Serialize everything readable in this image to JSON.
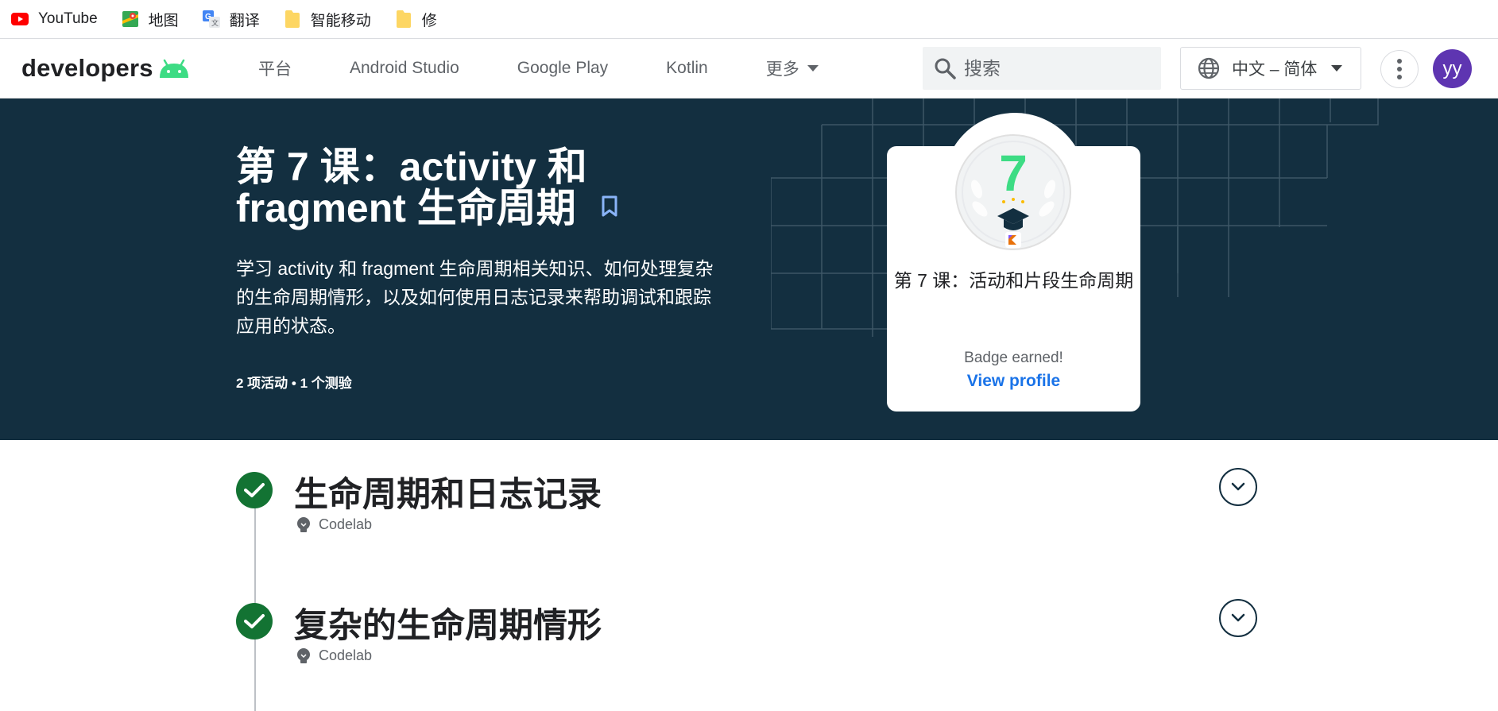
{
  "bookmarks": [
    {
      "label": "YouTube",
      "icon": "youtube-icon"
    },
    {
      "label": "地图",
      "icon": "maps-icon"
    },
    {
      "label": "翻译",
      "icon": "translate-icon"
    },
    {
      "label": "智能移动",
      "icon": "folder-icon"
    },
    {
      "label": "修",
      "icon": "folder-icon"
    }
  ],
  "nav": {
    "logo_text": "developers",
    "links": [
      "平台",
      "Android Studio",
      "Google Play",
      "Kotlin",
      "更多"
    ],
    "search_placeholder": "搜索",
    "language": "中文 – 简体",
    "avatar_initials": "yy"
  },
  "hero": {
    "title_line1": "第 7 课：activity 和",
    "title_line2": "fragment 生命周期",
    "description": "学习 activity 和 fragment 生命周期相关知识、如何处理复杂的生命周期情形，以及如何使用日志记录来帮助调试和跟踪应用的状态。",
    "meta": "2 项活动 • 1 个测验",
    "badge": {
      "number": "7",
      "title": "第 7 课：活动和片段生命周期",
      "earned": "Badge earned!",
      "link": "View profile"
    }
  },
  "activities": [
    {
      "title": "生命周期和日志记录",
      "type": "Codelab"
    },
    {
      "title": "复杂的生命周期情形",
      "type": "Codelab"
    }
  ],
  "colors": {
    "hero_bg": "#132f40",
    "accent_green": "#3ddc84",
    "check_green": "#137333",
    "link_blue": "#1a73e8",
    "avatar_purple": "#5e35b1"
  }
}
